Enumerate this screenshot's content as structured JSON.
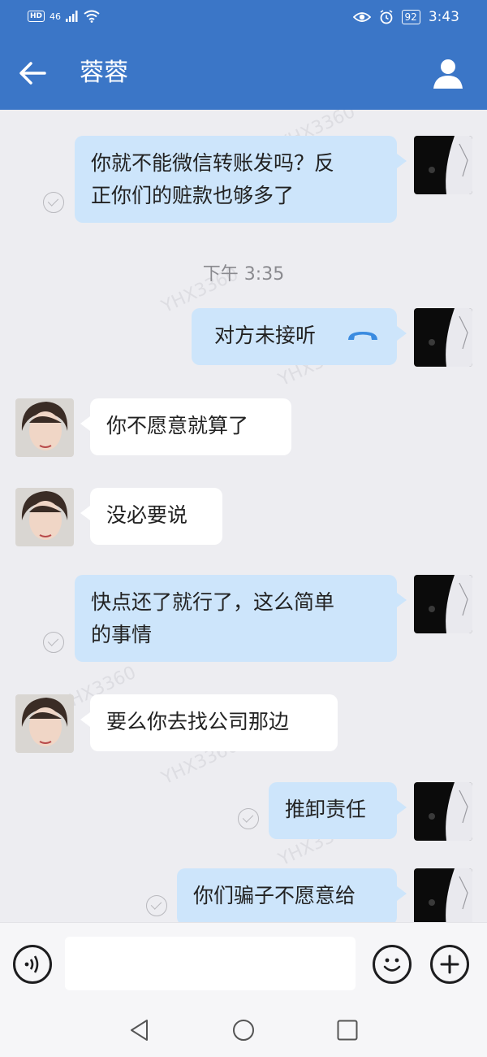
{
  "status_bar": {
    "network": "46",
    "battery": "92",
    "time": "3:43"
  },
  "header": {
    "title": "蓉蓉"
  },
  "chat": {
    "messages": [
      {
        "side": "me",
        "text_lines": [
          "你就不能微信转账发吗？反",
          "正你们的赃款也够多了"
        ]
      },
      {
        "side": "me",
        "text": "对方未接听",
        "type": "call"
      },
      {
        "side": "them",
        "text": "你不愿意就算了"
      },
      {
        "side": "them",
        "text": "没必要说"
      },
      {
        "side": "me",
        "text_lines": [
          "快点还了就行了，这么简单",
          "的事情"
        ]
      },
      {
        "side": "them",
        "text": "要么你去找公司那边"
      },
      {
        "side": "me",
        "text": "推卸责任"
      },
      {
        "side": "me",
        "text": "你们骗子不愿意给"
      }
    ],
    "timestamp": "下午 3:35",
    "watermark": "YHX3360"
  },
  "input": {
    "placeholder": ""
  },
  "icons": {
    "back": "arrow-left-icon",
    "profile": "person-icon",
    "voice": "voice-icon",
    "emoji": "emoji-icon",
    "plus": "plus-icon",
    "call": "phone-hangup-icon"
  },
  "colors": {
    "primary": "#3b76c7",
    "my_bubble": "#cde5fb",
    "their_bubble": "#ffffff",
    "background": "#ededf1"
  }
}
